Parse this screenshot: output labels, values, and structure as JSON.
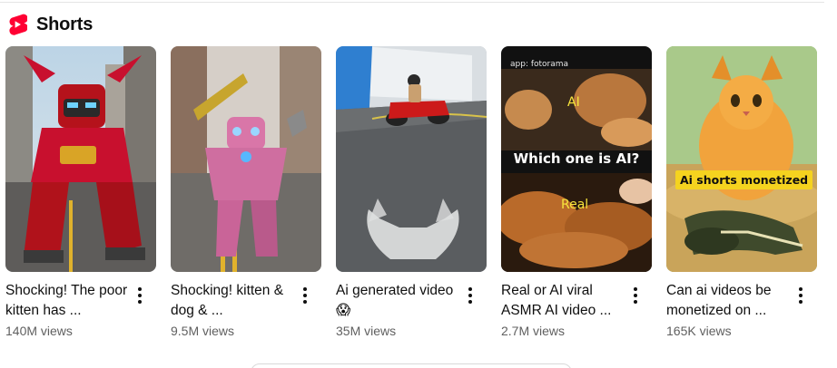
{
  "shelf": {
    "title": "Shorts",
    "logo_icon": "youtube-shorts-icon",
    "accent": "#ff0033"
  },
  "items": [
    {
      "title": "Shocking! The poor kitten has ...",
      "views": "140M views",
      "overlay": {}
    },
    {
      "title": "Shocking! kitten & dog & ...",
      "views": "9.5M views",
      "overlay": {}
    },
    {
      "title": "Ai generated video 😱",
      "views": "35M views",
      "overlay": {}
    },
    {
      "title": "Real or AI viral ASMR AI video ...",
      "views": "2.7M views",
      "overlay": {
        "watermark": "app: fotorama",
        "question": "Which one is AI?",
        "label_top": "AI",
        "label_bottom": "Real"
      }
    },
    {
      "title": "Can ai videos be monetized on ...",
      "views": "165K views",
      "overlay": {
        "banner": "Ai shorts monetized"
      }
    }
  ],
  "menu_icon": "more-vert-icon"
}
